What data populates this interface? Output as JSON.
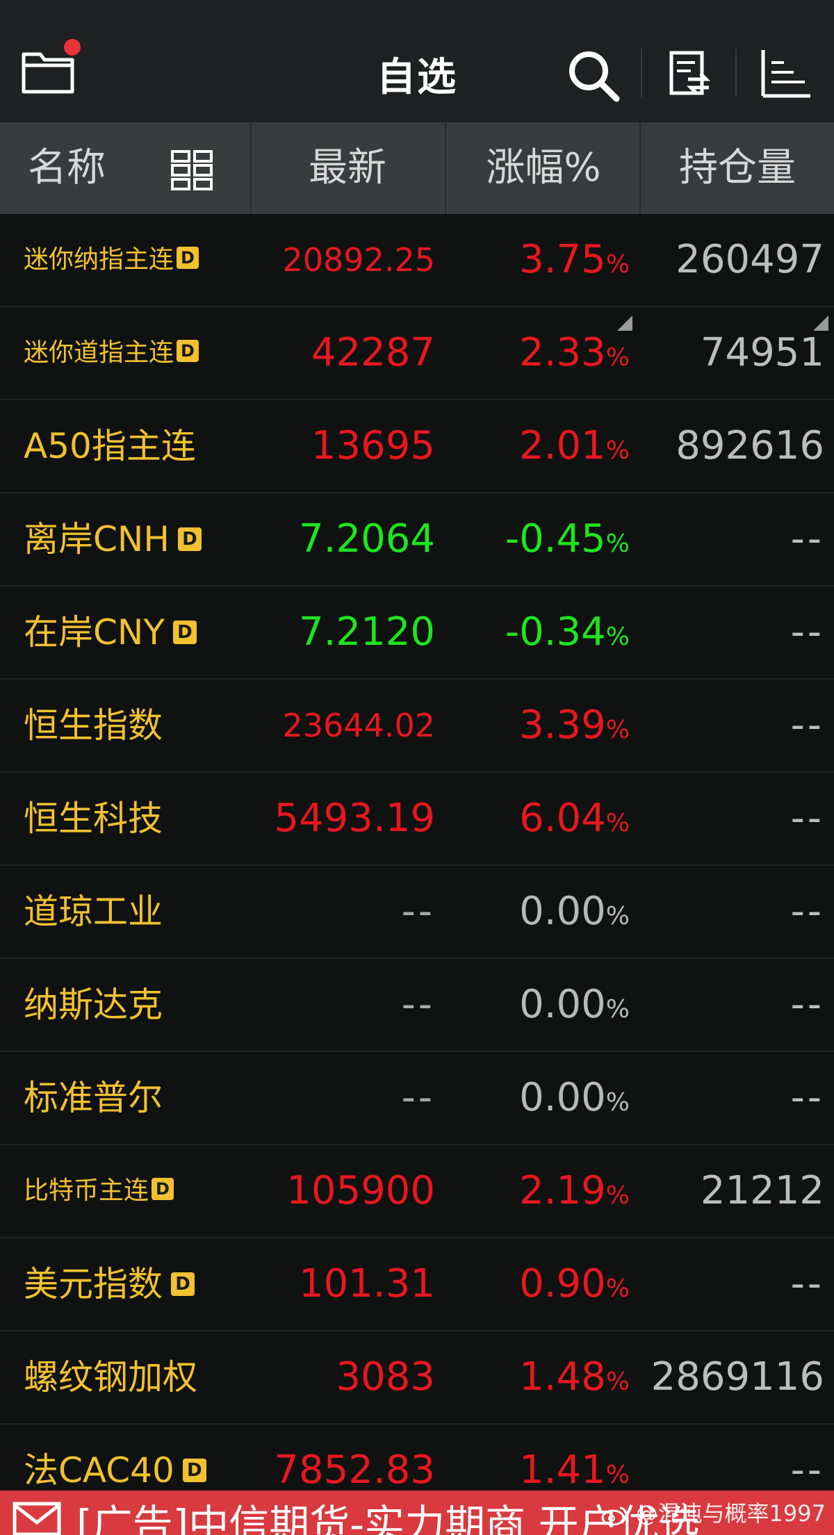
{
  "header": {
    "title": "自选",
    "icons": [
      "folder-icon",
      "notification-dot",
      "search-icon",
      "exchange-icon",
      "sort-list-icon"
    ]
  },
  "columns": {
    "name": "名称",
    "last": "最新",
    "change": "涨幅%",
    "open_interest": "持仓量"
  },
  "rows": [
    {
      "name": "迷你纳指主连",
      "badge": "D",
      "last": "20892.25",
      "change": "3.75",
      "pct": "%",
      "oi": "260497"
    },
    {
      "name": "迷你道指主连",
      "badge": "D",
      "last": "42287",
      "change": "2.33",
      "pct": "%",
      "oi": "74951"
    },
    {
      "name": "A50指主连",
      "badge": "",
      "last": "13695",
      "change": "2.01",
      "pct": "%",
      "oi": "892616"
    },
    {
      "name": "离岸CNH",
      "badge": "D",
      "last": "7.2064",
      "change": "-0.45",
      "pct": "%",
      "oi": "--"
    },
    {
      "name": "在岸CNY",
      "badge": "D",
      "last": "7.2120",
      "change": "-0.34",
      "pct": "%",
      "oi": "--"
    },
    {
      "name": "恒生指数",
      "badge": "",
      "last": "23644.02",
      "change": "3.39",
      "pct": "%",
      "oi": "--"
    },
    {
      "name": "恒生科技",
      "badge": "",
      "last": "5493.19",
      "change": "6.04",
      "pct": "%",
      "oi": "--"
    },
    {
      "name": "道琼工业",
      "badge": "",
      "last": "--",
      "change": "0.00",
      "pct": "%",
      "oi": "--"
    },
    {
      "name": "纳斯达克",
      "badge": "",
      "last": "--",
      "change": "0.00",
      "pct": "%",
      "oi": "--"
    },
    {
      "name": "标准普尔",
      "badge": "",
      "last": "--",
      "change": "0.00",
      "pct": "%",
      "oi": "--"
    },
    {
      "name": "比特币主连",
      "badge": "D",
      "last": "105900",
      "change": "2.19",
      "pct": "%",
      "oi": "21212"
    },
    {
      "name": "美元指数",
      "badge": "D",
      "last": "101.31",
      "change": "0.90",
      "pct": "%",
      "oi": "--"
    },
    {
      "name": "螺纹钢加权",
      "badge": "",
      "last": "3083",
      "change": "1.48",
      "pct": "%",
      "oi": "2869116"
    },
    {
      "name": "法CAC40",
      "badge": "D",
      "last": "7852.83",
      "change": "1.41",
      "pct": "%",
      "oi": "--"
    }
  ],
  "ad": {
    "text": "[广告]中信期货-实力期商 开户优选",
    "watermark": "@混沌与概率1997"
  },
  "colors": {
    "up": "#e8171f",
    "down": "#1ee51e",
    "flat": "#b8b8b8",
    "name": "#f2c130",
    "ad_bg": "#d83a40"
  }
}
